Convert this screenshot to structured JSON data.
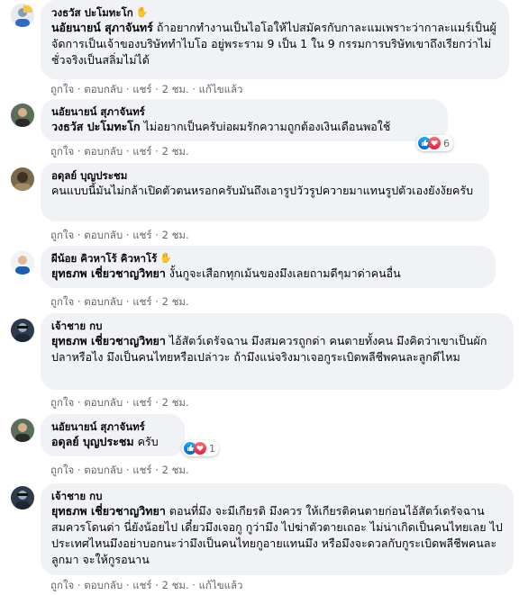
{
  "actions": {
    "like": "ถูกใจ",
    "reply": "ตอบกลับ",
    "share": "แชร์",
    "sep": " · ",
    "edited": "แก้ไขแล้ว"
  },
  "comments": [
    {
      "author": "วงธวัส ปะโมทะโก",
      "mention": "นอัยนายน์ สุภาจันทร์",
      "text": " ถ้าอยากทำงานเป็นไอโอให้ไปสมัครกับกาละแมเพราะว่ากาละแมร์เป็นผู้จัดการเป็นเจ้าของบริษัททำไบโอ อยู่พระราม 9 เป็น 1 ใน 9 กรรมการบริษัทเขาถึงเรียกว่าไม่ชั่วจริงเป็นสลิ่มไม่ได้",
      "time": "2 ชม.",
      "edited": true
    },
    {
      "author": "นอัยนายน์ สุภาจันทร์",
      "mention": "วงธวัส ปะโมทะโก",
      "text": " ไม่อยากเป็นครับiอผมรักความถูกต้องเงินเดือนพอใช้",
      "time": "2 ชม.",
      "reactions": "6"
    },
    {
      "author": "อดุลย์ บุญประชม",
      "mention": "",
      "text": "คนแบบนี้มันไม่กล้าเปิดตัวตนหรอกครับมันถึงเอารูปวัวรูปควายมาแทนรูปตัวเองยังงัยครับ",
      "time": "2 ชม."
    },
    {
      "author": "ผีน้อย คิวหาโร้ คิวหาโร้",
      "mention": "ยุทธภพ เชี่ยวชาญวิทยา",
      "text": " งั้นกูจะเสือกทุกเม้นของมึงเลยถามดีๆมาด่าคนอื่น",
      "time": "2 ชม."
    },
    {
      "author": "เจ้าชาย กบ",
      "mention": "ยุทธภพ เชี่ยวชาญวิทยา",
      "text": " ไอ้สัตว์เดรัจฉาน มึงสมควรถูกด่า คนตายทั้งคน มึงคิดว่าเขาเป็นผักปลาหรือไง มึงเป็นคนไทยหรือเปล่าวะ ถ้ามึงแน่จริงมาเจอกูระเบิดพลีชีพคนละลูกดีไหม",
      "time": "2 ชม."
    },
    {
      "author": "นอัยนายน์ สุภาจันทร์",
      "mention": "อดุลย์ บุญประชม",
      "text": " ครับ",
      "time": "2 ชม.",
      "reactions": "1"
    },
    {
      "author": "เจ้าชาย กบ",
      "mention": "ยุทธภพ เชี่ยวชาญวิทยา",
      "text": " ตอนที่มึง จะมีเกียรติ มึงควร ให้เกียรติคนตายก่อนไอ้สัตว์เดรัจฉานสมควรโดนด่า นี่ยังน้อยไป เดี๋ยวมึงเจอกู กูว่ามึง ไปฆ่าตัวตายเถอะ ไม่น่าเกิดเป็นคนไทยเลย ไปประเทศไหนมึงอย่าบอกนะว่ามึงเป็นคนไทยกูอายแทนมึง หรือมึงจะดวลกับกูระเบิดพลีชีพคนละลูกมา จะให้กูรอนาน",
      "time": "2 ชม.",
      "edited": true
    }
  ]
}
